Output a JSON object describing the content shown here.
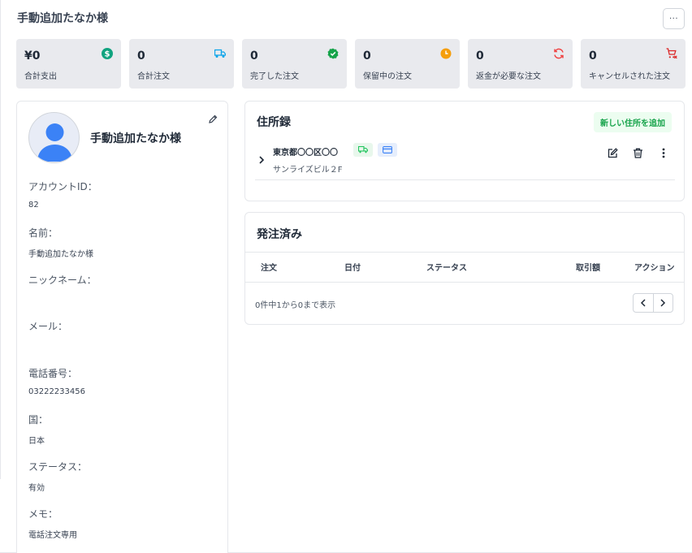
{
  "header": {
    "title": "手動追加たなか様",
    "more_label": "···"
  },
  "stats": [
    {
      "value": "¥0",
      "label": "合計支出",
      "icon": "dollar-icon",
      "color": "#10a37f"
    },
    {
      "value": "0",
      "label": "合計注文",
      "icon": "truck-icon",
      "color": "#0ea5e9"
    },
    {
      "value": "0",
      "label": "完了した注文",
      "icon": "check-badge-icon",
      "color": "#16a34a"
    },
    {
      "value": "0",
      "label": "保留中の注文",
      "icon": "clock-icon",
      "color": "#f59e0b"
    },
    {
      "value": "0",
      "label": "返金が必要な注文",
      "icon": "refresh-icon",
      "color": "#ef4444"
    },
    {
      "value": "0",
      "label": "キャンセルされた注文",
      "icon": "cart-cancel-icon",
      "color": "#dc2626"
    }
  ],
  "profile": {
    "name": "手動追加たなか様",
    "fields": [
      {
        "label": "アカウントID：",
        "value": "82"
      },
      {
        "label": "名前：",
        "value": "手動追加たなか様"
      },
      {
        "label": "ニックネーム：",
        "value": ""
      },
      {
        "label": "メール：",
        "value": ""
      },
      {
        "label": "電話番号：",
        "value": "03222233456"
      },
      {
        "label": "国：",
        "value": "日本"
      },
      {
        "label": "ステータス：",
        "value": "有効"
      },
      {
        "label": "メモ：",
        "value": "電話注文専用"
      }
    ]
  },
  "address_book": {
    "title": "住所録",
    "add_button": "新しい住所を追加",
    "address": {
      "line1": "東京都〇〇区〇〇",
      "line2": "サンライズビル２F"
    }
  },
  "orders": {
    "title": "発注済み",
    "columns": [
      "注文",
      "日付",
      "ステータス",
      "取引額",
      "アクション"
    ],
    "pager_info": "0件中1から0まで表示"
  },
  "colors": {
    "accent_green": "#16a34a",
    "avatar_blue": "#3b82f6"
  }
}
